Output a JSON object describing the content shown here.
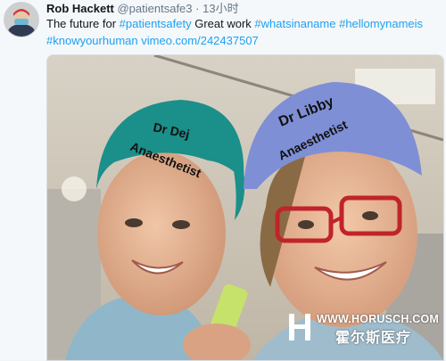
{
  "tweet": {
    "author_name": "Rob Hackett",
    "handle": "@patientsafe3",
    "separator": "·",
    "time": "13小时",
    "text_parts": {
      "lead": "The future for ",
      "tag_patientsafety": "#patientsafety",
      "middle": " Great work ",
      "tag_whatsinaname": "#whatsinaname",
      "tag_hellomynameis": "#hellomynameis",
      "tag_knowyourhuman": "#knowyourhuman",
      "link": "vimeo.com/242437507"
    }
  },
  "photo": {
    "left_cap_line1": "Dr Dej",
    "left_cap_line2": "Anaesthetist",
    "right_cap_line1": "Dr Libby",
    "right_cap_line2": "Anaesthetist",
    "left_cap_color": "#1b8f8a",
    "right_cap_color": "#7f8fd6"
  },
  "watermark": {
    "url": "WWW.HORUSCH.COM",
    "cn_name": "霍尔斯医疗"
  }
}
